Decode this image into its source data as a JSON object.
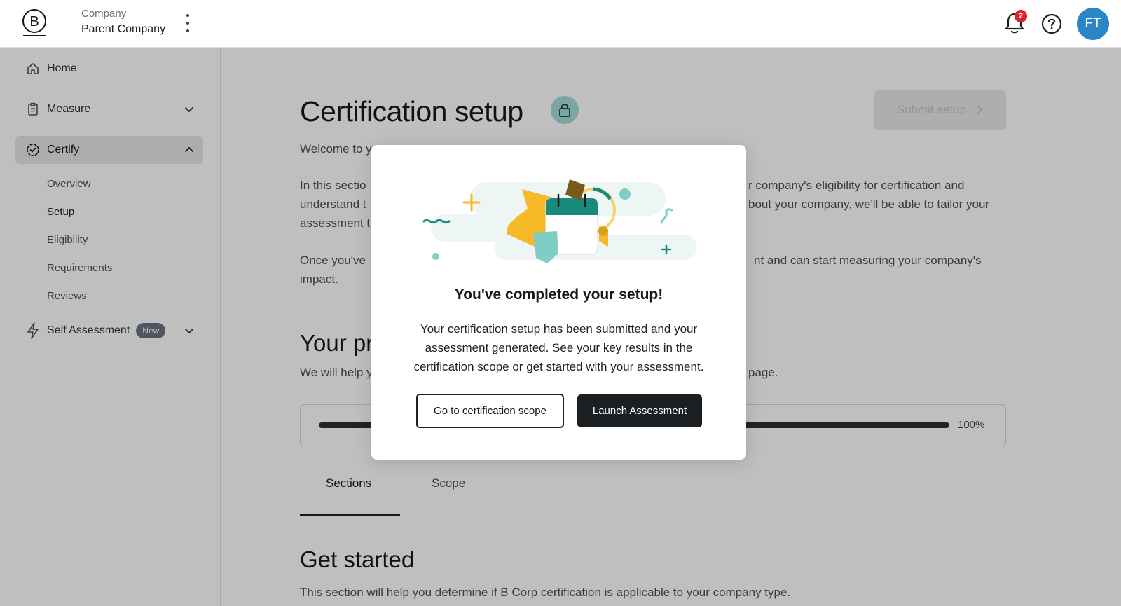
{
  "header": {
    "company_label": "Company",
    "company_name": "Parent Company",
    "notification_count": "2",
    "avatar_initials": "FT",
    "avatar_color": "#2b86c5"
  },
  "sidebar": {
    "items": [
      {
        "label": "Home",
        "icon": "home-icon"
      },
      {
        "label": "Measure",
        "icon": "clipboard-icon"
      },
      {
        "label": "Certify",
        "icon": "certify-badge-icon"
      },
      {
        "label": "Self Assessment",
        "icon": "lightning-icon",
        "badge": "New"
      }
    ],
    "certify_subitems": [
      "Overview",
      "Setup",
      "Eligibility",
      "Requirements",
      "Reviews"
    ]
  },
  "main": {
    "title": "Certification setup",
    "submit_label": "Submit setup",
    "welcome_text": "Welcome to y",
    "para1_left": "In this sectio",
    "para1_left_2": "understand t",
    "para1_left_3": "assessment t",
    "para1_right_1": "r company's eligibility for certification and",
    "para1_right_2": "bout your company, we'll be able to tailor your",
    "para2_left_1": "Once you've",
    "para2_left_2": "impact.",
    "para2_right_1": "nt and can start measuring your company's",
    "progress_heading": "Your pr",
    "progress_text_left": "We will help y",
    "progress_text_right": "page.",
    "progress_percent": "100%",
    "progress_value": 1.0,
    "tabs": [
      "Sections",
      "Scope"
    ],
    "section_heading": "Get started",
    "section_text": "This section will help you determine if B Corp certification is applicable to your company type."
  },
  "modal": {
    "title": "You've completed your setup!",
    "body": "Your certification setup has been submitted and your assessment generated. See your key results in the certification scope or get started with your assessment.",
    "secondary_button": "Go to certification scope",
    "primary_button": "Launch Assessment"
  },
  "colors": {
    "accent_teal": "#1a8a7a",
    "accent_yellow": "#f7b928",
    "badge_red": "#e0202c"
  }
}
